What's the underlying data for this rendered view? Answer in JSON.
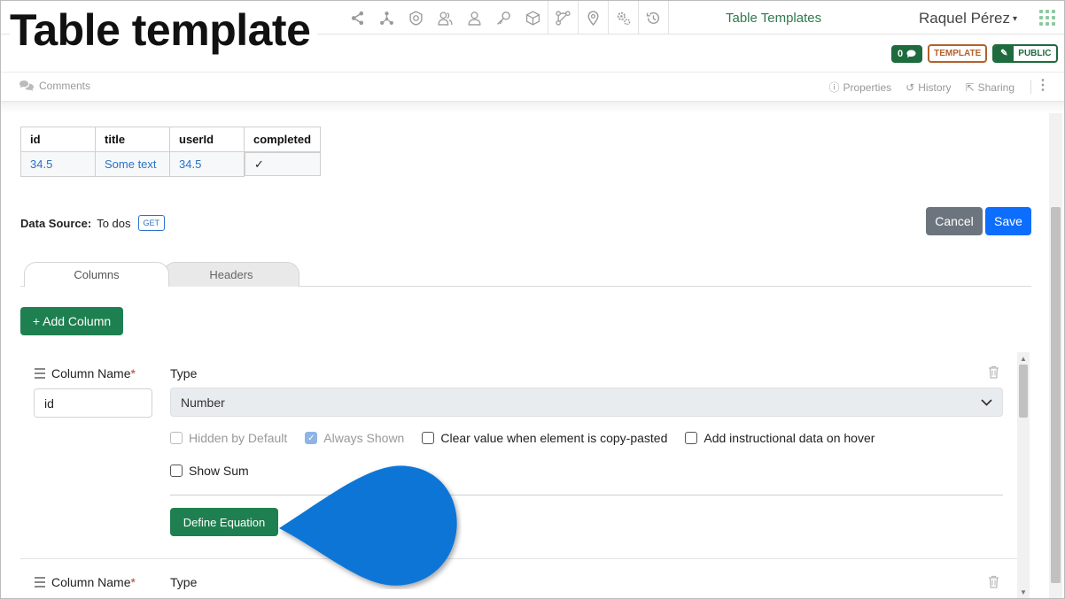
{
  "overlay_title": "Table template",
  "header": {
    "toolbar_icons": [
      "share-icon",
      "network-icon",
      "shield-icon",
      "users-icon",
      "user-icon",
      "key-icon",
      "cube-icon",
      "workflow-icon",
      "location-pin-icon",
      "settings-gears-icon",
      "history-icon"
    ],
    "breadcrumb": "Table Templates",
    "user_name": "Raquel Pérez",
    "comment_count": "0",
    "template_badge": "TEMPLATE",
    "public_badge": "PUBLIC"
  },
  "subbar": {
    "comments": "Comments",
    "properties": "Properties",
    "history": "History",
    "sharing": "Sharing"
  },
  "preview_table": {
    "headers": [
      "id",
      "title",
      "userId",
      "completed"
    ],
    "row": [
      "34.5",
      "Some text",
      "34.5",
      "✓"
    ]
  },
  "data_source": {
    "label": "Data Source:",
    "value": "To dos",
    "method": "GET"
  },
  "actions": {
    "cancel": "Cancel",
    "save": "Save"
  },
  "tabs": [
    "Columns",
    "Headers"
  ],
  "add_column": "+ Add Column",
  "column_editor": {
    "name_label": "Column Name",
    "required_mark": "*",
    "name_value": "id",
    "type_label": "Type",
    "type_value": "Number",
    "options": [
      {
        "label": "Hidden by Default",
        "checked": false,
        "disabled": true
      },
      {
        "label": "Always Shown",
        "checked": true,
        "disabled": true
      },
      {
        "label": "Clear value when element is copy-pasted",
        "checked": false,
        "disabled": false
      },
      {
        "label": "Add instructional data on hover",
        "checked": false,
        "disabled": false
      }
    ],
    "show_sum": "Show Sum",
    "define_equation": "Define Equation"
  },
  "column_editor_2": {
    "name_label": "Column Name",
    "required_mark": "*",
    "type_label": "Type"
  },
  "colors": {
    "primary_green": "#1e8050",
    "save_blue": "#0d6efd",
    "cancel_gray": "#6c757d",
    "template_orange": "#b3612a",
    "callout_blue": "#0b74d6"
  }
}
